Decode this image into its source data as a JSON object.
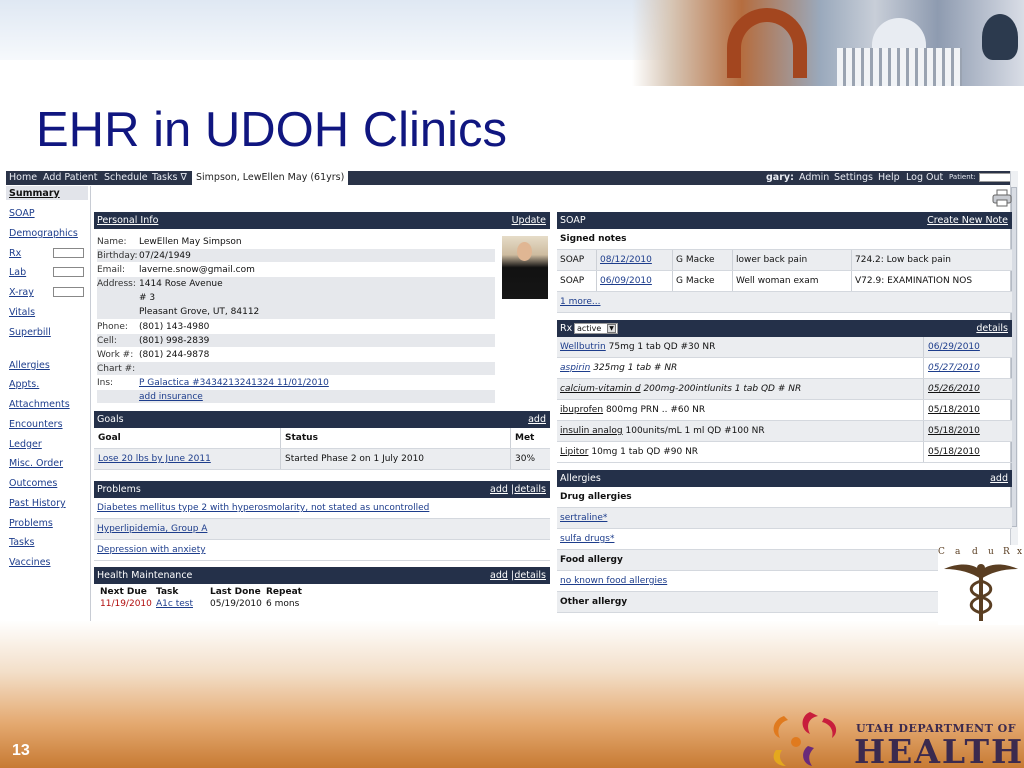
{
  "slide": {
    "title": "EHR in UDOH Clinics",
    "number": "13",
    "logo_small": "UTAH DEPARTMENT OF",
    "logo_big": "HEALTH",
    "cadurx_letters": [
      "C",
      "a",
      "d",
      "u",
      "R",
      "x"
    ]
  },
  "topbar": {
    "left_items": [
      "Home",
      "Add Patient",
      "Schedule",
      "Tasks ∇"
    ],
    "active_tab": "Simpson, LewEllen May (61yrs)",
    "user": "gary:",
    "right_items": [
      "Admin",
      "Settings",
      "Help",
      "Log Out"
    ],
    "patient_label": "Patient:"
  },
  "leftnav": {
    "items": [
      "Summary",
      "SOAP",
      "Demographics",
      "Rx",
      "Lab",
      "X-ray",
      "Vitals",
      "Superbill",
      "Allergies",
      "Appts.",
      "Attachments",
      "Encounters",
      "Ledger",
      "Misc. Order",
      "Outcomes",
      "Past History",
      "Problems",
      "Tasks",
      "Vaccines"
    ]
  },
  "personal_info": {
    "header": "Personal Info",
    "update": "Update",
    "lines": [
      {
        "label": "Name:",
        "value": "LewEllen May Simpson"
      },
      {
        "label": "Birthday:",
        "value": "07/24/1949"
      },
      {
        "label": "Email:",
        "value": "laverne.snow@gmail.com"
      },
      {
        "label": "Address:",
        "value": "1414 Rose Avenue"
      },
      {
        "label": "",
        "value": "# 3"
      },
      {
        "label": "",
        "value": "Pleasant Grove, UT, 84112"
      },
      {
        "label": "Phone:",
        "value": "(801) 143-4980"
      },
      {
        "label": "Cell:",
        "value": "(801) 998-2839"
      },
      {
        "label": "Work #:",
        "value": "(801) 244-9878"
      },
      {
        "label": "Chart #:",
        "value": ""
      },
      {
        "label": "Ins:",
        "value": "P Galactica #3434213241324 11/01/2010"
      },
      {
        "label": "",
        "value": "add insurance"
      }
    ]
  },
  "goals": {
    "header": "Goals",
    "add": "add",
    "columns": [
      "Goal",
      "Status",
      "Met"
    ],
    "rows": [
      [
        "Lose 20 lbs by June 2011",
        "Started Phase 2 on 1 July 2010",
        "30%"
      ]
    ]
  },
  "problems": {
    "header": "Problems",
    "add": "add",
    "details": "details",
    "items": [
      "Diabetes mellitus type 2 with hyperosmolarity, not stated as uncontrolled",
      "Hyperlipidemia, Group A",
      "Depression with anxiety"
    ]
  },
  "health_maintenance": {
    "header": "Health Maintenance",
    "add": "add",
    "details": "details",
    "columns": [
      "Next Due",
      "Task",
      "Last Done",
      "Repeat"
    ],
    "rows": [
      [
        "11/19/2010",
        "A1c test",
        "05/19/2010",
        "6 mons"
      ]
    ]
  },
  "soap": {
    "header": "SOAP",
    "create": "Create New Note",
    "subheader": "Signed notes",
    "rows": [
      [
        "SOAP",
        "08/12/2010",
        "G Macke",
        "lower back pain",
        "724.2: Low back pain"
      ],
      [
        "SOAP",
        "06/09/2010",
        "G Macke",
        "Well woman exam",
        "V72.9: EXAMINATION NOS"
      ]
    ],
    "more": "1 more..."
  },
  "rx": {
    "header": "Rx",
    "filter": "active",
    "details": "details",
    "rows": [
      {
        "drug": "Wellbutrin",
        "sig": "75mg 1 tab QD #30 NR",
        "date": "06/29/2010",
        "italic": false
      },
      {
        "drug": "aspirin",
        "sig": "325mg 1 tab # NR",
        "date": "05/27/2010",
        "italic": true
      },
      {
        "drug": "calcium-vitamin d",
        "sig": "200mg-200intlunits 1 tab QD # NR",
        "date": "05/26/2010",
        "italic": true
      },
      {
        "drug": "ibuprofen",
        "sig": "800mg PRN .. #60 NR",
        "date": "05/18/2010",
        "italic": false
      },
      {
        "drug": "insulin analog",
        "sig": "100units/mL 1 ml QD #100 NR",
        "date": "05/18/2010",
        "italic": false
      },
      {
        "drug": "Lipitor",
        "sig": "10mg 1 tab QD #90 NR",
        "date": "05/18/2010",
        "italic": false
      }
    ]
  },
  "allergies": {
    "header": "Allergies",
    "add": "add",
    "drug_label": "Drug allergies",
    "drug_items": [
      "sertraline*",
      "sulfa drugs*"
    ],
    "food_label": "Food allergy",
    "food_items": [
      "no known food allergies"
    ],
    "other_label": "Other allergy"
  }
}
